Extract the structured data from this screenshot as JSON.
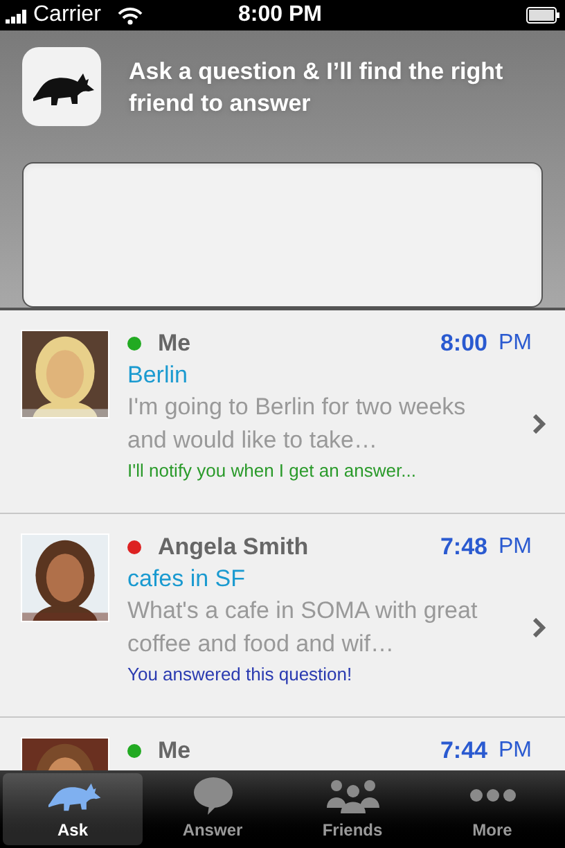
{
  "status_bar": {
    "carrier": "Carrier",
    "time": "8:00 PM"
  },
  "header": {
    "prompt": "Ask a question & I’ll find the right friend to answer"
  },
  "questions": [
    {
      "name": "Me",
      "color": "#22aa22",
      "time": "8:00",
      "ampm": "PM",
      "topic": "Berlin",
      "text": "I'm going to Berlin for two weeks and would like to take…",
      "note": "I'll notify you when I get an answer...",
      "kind": "pending"
    },
    {
      "name": "Angela Smith",
      "color": "#dd2222",
      "time": "7:48",
      "ampm": "PM",
      "topic": "cafes in SF",
      "text": "What's a cafe in SOMA with great coffee and food and wif…",
      "note": "You answered this question!",
      "kind": "answered"
    },
    {
      "name": "Me",
      "color": "#22aa22",
      "time": "7:44",
      "ampm": "PM"
    }
  ],
  "tabs": [
    {
      "label": "Ask",
      "selected": true,
      "kind": "ask"
    },
    {
      "label": "Answer",
      "selected": false,
      "kind": "answer"
    },
    {
      "label": "Friends",
      "selected": false,
      "kind": "friends"
    },
    {
      "label": "More",
      "selected": false,
      "kind": "more"
    }
  ]
}
